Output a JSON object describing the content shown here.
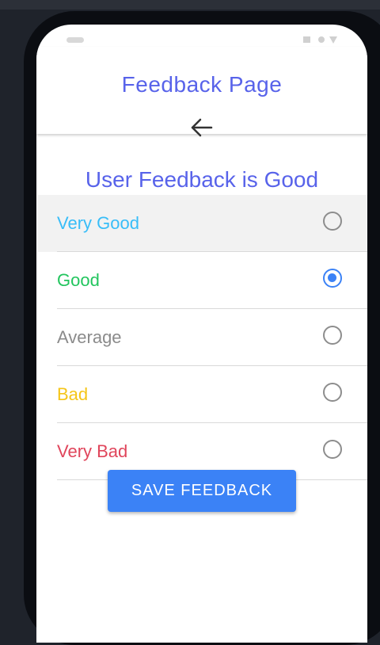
{
  "app": {
    "title": "Feedback Page"
  },
  "header": {
    "back_icon": "arrow-left-icon"
  },
  "status": {
    "headline": "User Feedback is Good"
  },
  "options": [
    {
      "label": "Very Good",
      "color": "#38bdf8",
      "selected": false,
      "highlighted": true
    },
    {
      "label": "Good",
      "color": "#22c55e",
      "selected": true,
      "highlighted": false
    },
    {
      "label": "Average",
      "color": "#8b8b8b",
      "selected": false,
      "highlighted": false
    },
    {
      "label": "Bad",
      "color": "#f5c518",
      "selected": false,
      "highlighted": false
    },
    {
      "label": "Very Bad",
      "color": "#e0455b",
      "selected": false,
      "highlighted": false
    }
  ],
  "actions": {
    "save_label": "SAVE FEEDBACK"
  },
  "colors": {
    "accent": "#3b82f6",
    "title": "#5863ea",
    "background": "#1f232b",
    "phone_frame": "#0b0d12"
  }
}
